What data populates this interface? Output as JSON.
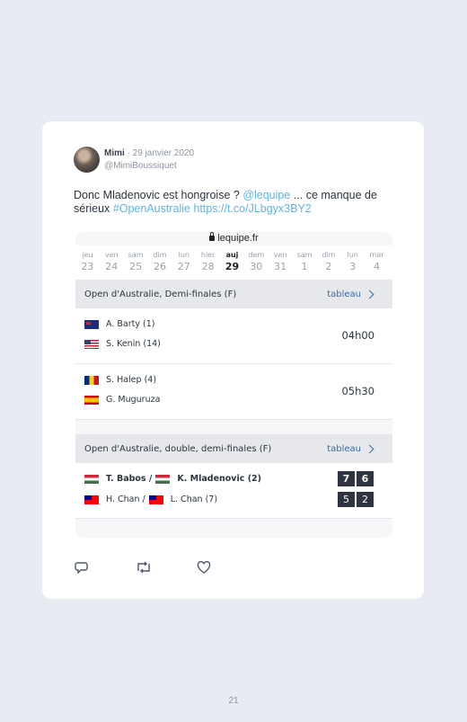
{
  "tweet": {
    "author_name": "Mimi",
    "date": "· 29 janvier 2020",
    "handle": "@MimiBoussiquet",
    "text_1": "Donc Mladenovic est hongroise ? ",
    "mention": "@lequipe",
    "text_2": " ... ce manque de sérieux ",
    "hashtag": "#OpenAustralie",
    "text_3": " ",
    "link": "https://t.co/JLbgyx3BY2"
  },
  "embed": {
    "domain": "lequipe.fr",
    "days": [
      {
        "label": "jeu",
        "num": "23"
      },
      {
        "label": "ven",
        "num": "24"
      },
      {
        "label": "sam",
        "num": "25"
      },
      {
        "label": "dim",
        "num": "26"
      },
      {
        "label": "lun",
        "num": "27"
      },
      {
        "label": "hier",
        "num": "28"
      },
      {
        "label": "auj",
        "num": "29"
      },
      {
        "label": "dem",
        "num": "30"
      },
      {
        "label": "ven",
        "num": "31"
      },
      {
        "label": "sam",
        "num": "1"
      },
      {
        "label": "dim",
        "num": "2"
      },
      {
        "label": "lun",
        "num": "3"
      },
      {
        "label": "mar",
        "num": "4"
      }
    ],
    "section1": {
      "title": "Open d'Australie, Demi-finales (F)",
      "link": "tableau",
      "matches": [
        {
          "p1": "A. Barty (1)",
          "p2": "S. Kenin (14)",
          "time": "04h00"
        },
        {
          "p1": "S. Halep (4)",
          "p2": "G. Muguruza",
          "time": "05h30"
        }
      ]
    },
    "section2": {
      "title": "Open d'Australie, double, demi-finales (F)",
      "link": "tableau",
      "team1_a": "T. Babos /",
      "team1_b": "K. Mladenovic (2)",
      "team2_a": "H. Chan /",
      "team2_b": "L. Chan (7)",
      "score_team1": [
        "7",
        "6"
      ],
      "score_team2": [
        "5",
        "2"
      ]
    }
  },
  "icons": [
    "reply-icon",
    "retweet-icon",
    "like-icon"
  ],
  "page_number": "21"
}
